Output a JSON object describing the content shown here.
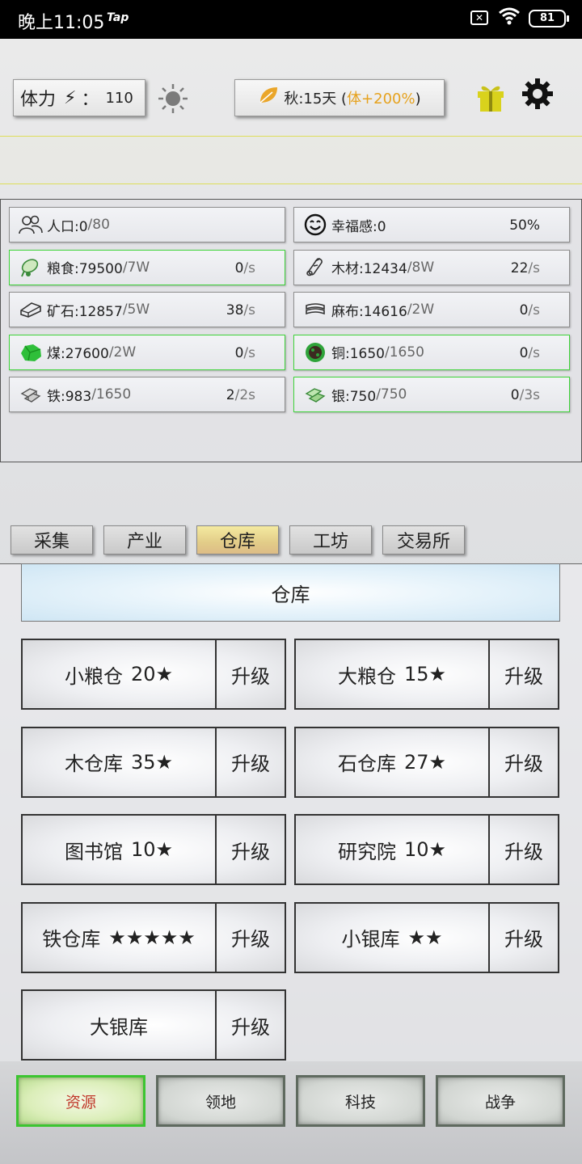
{
  "status_bar": {
    "time": "晚上11:05",
    "app_tag": "Tap",
    "battery": "81"
  },
  "header": {
    "stamina_label": "体力",
    "stamina_sep": "：",
    "stamina_value": "110",
    "season_text": "秋:15天 (",
    "season_bonus": "体+200%",
    "season_close": ")"
  },
  "resources": [
    {
      "icon": "people-icon",
      "name": "人口:0",
      "cap": "/80",
      "rate": "",
      "unit": "",
      "highlight": false
    },
    {
      "icon": "smile-icon",
      "name": "幸福感:0",
      "cap": "",
      "rate": "50%",
      "unit": "",
      "highlight": false
    },
    {
      "icon": "grain-icon",
      "name": "粮食:79500",
      "cap": "/7W",
      "rate": "0",
      "unit": "/s",
      "highlight": true
    },
    {
      "icon": "wood-icon",
      "name": "木材:12434",
      "cap": "/8W",
      "rate": "22",
      "unit": "/s",
      "highlight": false
    },
    {
      "icon": "ore-icon",
      "name": "矿石:12857",
      "cap": "/5W",
      "rate": "38",
      "unit": "/s",
      "highlight": false
    },
    {
      "icon": "cloth-icon",
      "name": "麻布:14616",
      "cap": "/2W",
      "rate": "0",
      "unit": "/s",
      "highlight": false
    },
    {
      "icon": "coal-icon",
      "name": "煤:27600",
      "cap": "/2W",
      "rate": "0",
      "unit": "/s",
      "highlight": true
    },
    {
      "icon": "copper-icon",
      "name": "铜:1650",
      "cap": "/1650",
      "rate": "0",
      "unit": "/s",
      "highlight": true
    },
    {
      "icon": "iron-icon",
      "name": "铁:983",
      "cap": "/1650",
      "rate": "2",
      "unit": "/2s",
      "highlight": false
    },
    {
      "icon": "silver-icon",
      "name": "银:750",
      "cap": "/750",
      "rate": "0",
      "unit": "/3s",
      "highlight": true
    }
  ],
  "tabs": [
    {
      "label": "采集",
      "active": false
    },
    {
      "label": "产业",
      "active": false
    },
    {
      "label": "仓库",
      "active": true
    },
    {
      "label": "工坊",
      "active": false
    },
    {
      "label": "交易所",
      "active": false
    }
  ],
  "section_title": "仓库",
  "buildings": [
    {
      "name": "小粮仓",
      "stars": "20★",
      "action": "升级"
    },
    {
      "name": "大粮仓",
      "stars": "15★",
      "action": "升级"
    },
    {
      "name": "木仓库",
      "stars": "35★",
      "action": "升级"
    },
    {
      "name": "石仓库",
      "stars": "27★",
      "action": "升级"
    },
    {
      "name": "图书馆",
      "stars": "10★",
      "action": "升级"
    },
    {
      "name": "研究院",
      "stars": "10★",
      "action": "升级"
    },
    {
      "name": "铁仓库",
      "stars": "★★★★★",
      "action": "升级"
    },
    {
      "name": "小银库",
      "stars": "★★",
      "action": "升级"
    },
    {
      "name": "大银库",
      "stars": "",
      "action": "升级"
    }
  ],
  "bottom_nav": [
    {
      "label": "资源",
      "active": true
    },
    {
      "label": "领地",
      "active": false
    },
    {
      "label": "科技",
      "active": false
    },
    {
      "label": "战争",
      "active": false
    }
  ],
  "colors": {
    "highlight_green": "#3fd43a",
    "active_tab": "#e8d792",
    "bonus_orange": "#e6a21e"
  }
}
